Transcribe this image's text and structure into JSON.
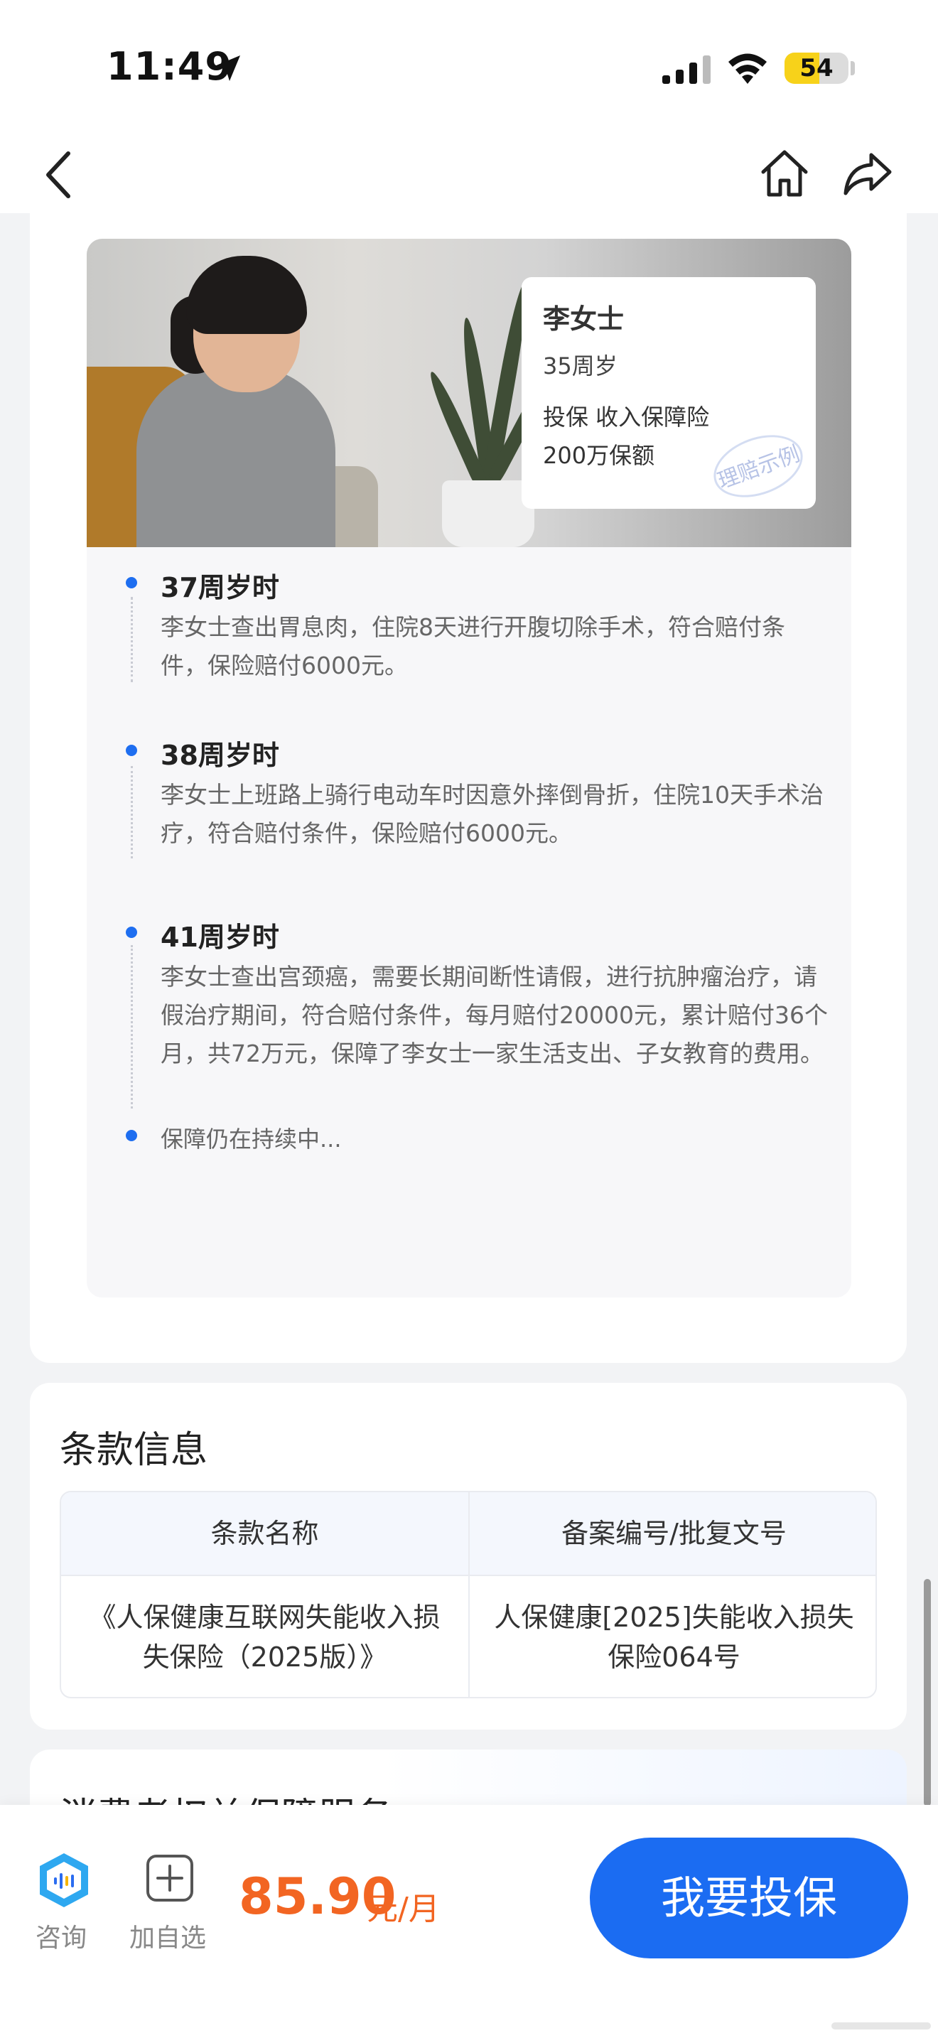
{
  "status_bar": {
    "time": "11:49",
    "battery": "54",
    "battery_level": 0.54
  },
  "case": {
    "name": "李女士",
    "age": "35周岁",
    "product": "投保 收入保障险",
    "amount": "200万保额",
    "stamp": "理赔示例",
    "timeline": [
      {
        "title": "37周岁时",
        "desc": "李女士查出胃息肉，住院8天进行开腹切除手术，符合赔付条件，保险赔付6000元。"
      },
      {
        "title": "38周岁时",
        "desc": "李女士上班路上骑行电动车时因意外摔倒骨折，住院10天手术治疗，符合赔付条件，保险赔付6000元。"
      },
      {
        "title": "41周岁时",
        "desc": "李女士查出宫颈癌，需要长期间断性请假，进行抗肿瘤治疗，请假治疗期间，符合赔付条件，每月赔付20000元，累计赔付36个月，共72万元，保障了李女士一家生活支出、子女教育的费用。"
      }
    ],
    "ongoing": "保障仍在持续中..."
  },
  "terms": {
    "title": "条款信息",
    "col_name": "条款名称",
    "col_filing": "备案编号/批复文号",
    "rows": [
      {
        "name": "《人保健康互联网失能收入损失保险（2025版）》",
        "filing": "人保健康[2025]失能收入损失保险064号"
      }
    ]
  },
  "consumer": {
    "title": "消费者权益保障服务"
  },
  "bottom_bar": {
    "consult_label": "咨询",
    "watch_label": "加自选",
    "price": "85.90",
    "price_unit": "元/月",
    "buy_label": "我要投保"
  },
  "colors": {
    "accent": "#1b6cf2",
    "price": "#f26522",
    "timeline_dot": "#1e6ef0"
  },
  "icons": [
    "location-arrow-icon",
    "signal-icon",
    "wifi-icon",
    "back-icon",
    "home-icon",
    "share-icon",
    "consult-icon",
    "add-watch-icon"
  ]
}
